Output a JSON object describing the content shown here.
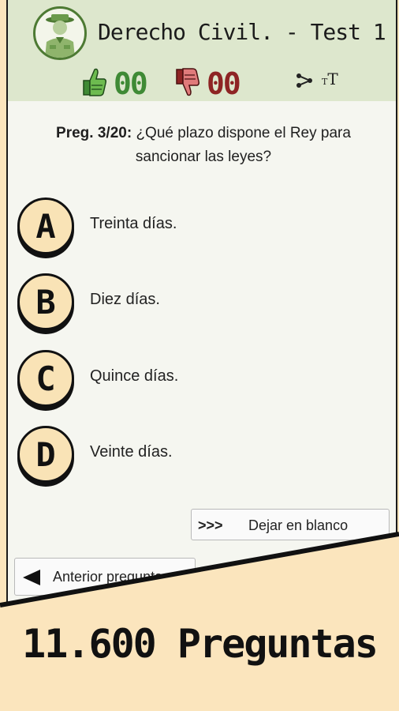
{
  "header": {
    "title": "Derecho Civil. - Test 1 -",
    "correct_count": "00",
    "wrong_count": "00",
    "font_size_small": "T",
    "font_size_large": "T"
  },
  "question": {
    "label": "Preg. 3/20:",
    "text": "¿Qué plazo dispone el Rey para sancionar las leyes?"
  },
  "options": [
    {
      "letter": "A",
      "text": "Treinta días."
    },
    {
      "letter": "B",
      "text": "Diez días."
    },
    {
      "letter": "C",
      "text": "Quince días."
    },
    {
      "letter": "D",
      "text": "Veinte días."
    }
  ],
  "buttons": {
    "blank_arrows": ">>>",
    "blank_label": "Dejar en blanco",
    "prev_label": "Anterior pregunta"
  },
  "banner": {
    "text": "11.600 Preguntas"
  },
  "colors": {
    "header_bg": "#dde7cd",
    "correct": "#3f8a35",
    "wrong": "#8e2424",
    "badge_bg": "#f9e3b6",
    "banner_bg": "#fbe5bd"
  },
  "icons": [
    "soldier-avatar-icon",
    "thumbs-up-icon",
    "thumbs-down-icon",
    "share-icon",
    "font-size-icon",
    "left-arrow-icon"
  ]
}
